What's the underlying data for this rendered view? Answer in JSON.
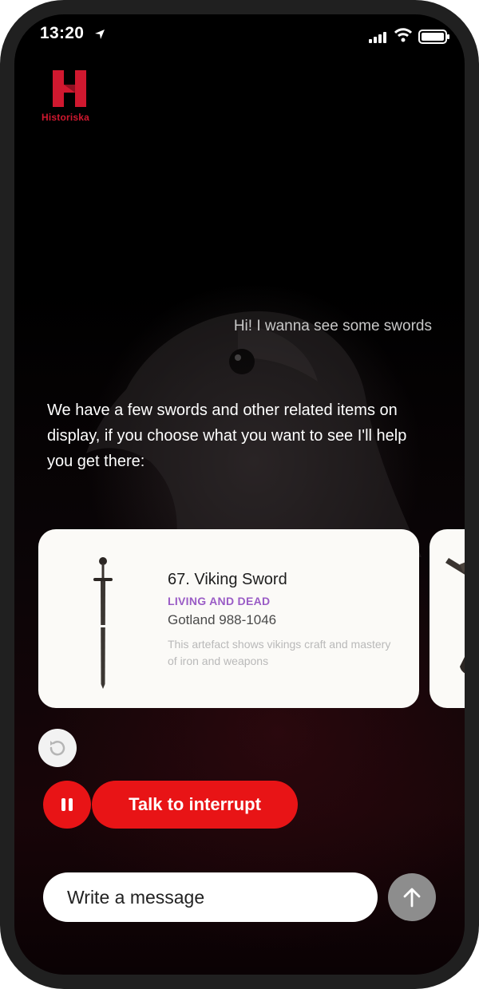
{
  "status_bar": {
    "time": "13:20",
    "icons": [
      "location-arrow-icon",
      "signal-icon",
      "wifi-icon",
      "battery-icon"
    ]
  },
  "brand": {
    "name": "Historiska",
    "color": "#d0182f"
  },
  "conversation": {
    "user_message": "Hi! I wanna see some swords",
    "assistant_message": "We have a few swords and other related items on display,  if you choose what you want to see I'll help you get there:"
  },
  "cards": [
    {
      "title": "67. Viking Sword",
      "category": "LIVING AND DEAD",
      "location": "Gotland 988-1046",
      "description": "This artefact shows vikings craft and mastery of iron and weapons",
      "icon": "sword-image"
    }
  ],
  "controls": {
    "replay_icon": "replay-icon",
    "pause_icon": "pause-icon",
    "talk_label": "Talk to interrupt",
    "accent_color": "#e81416"
  },
  "composer": {
    "placeholder": "Write a message",
    "send_icon": "arrow-up-icon"
  }
}
